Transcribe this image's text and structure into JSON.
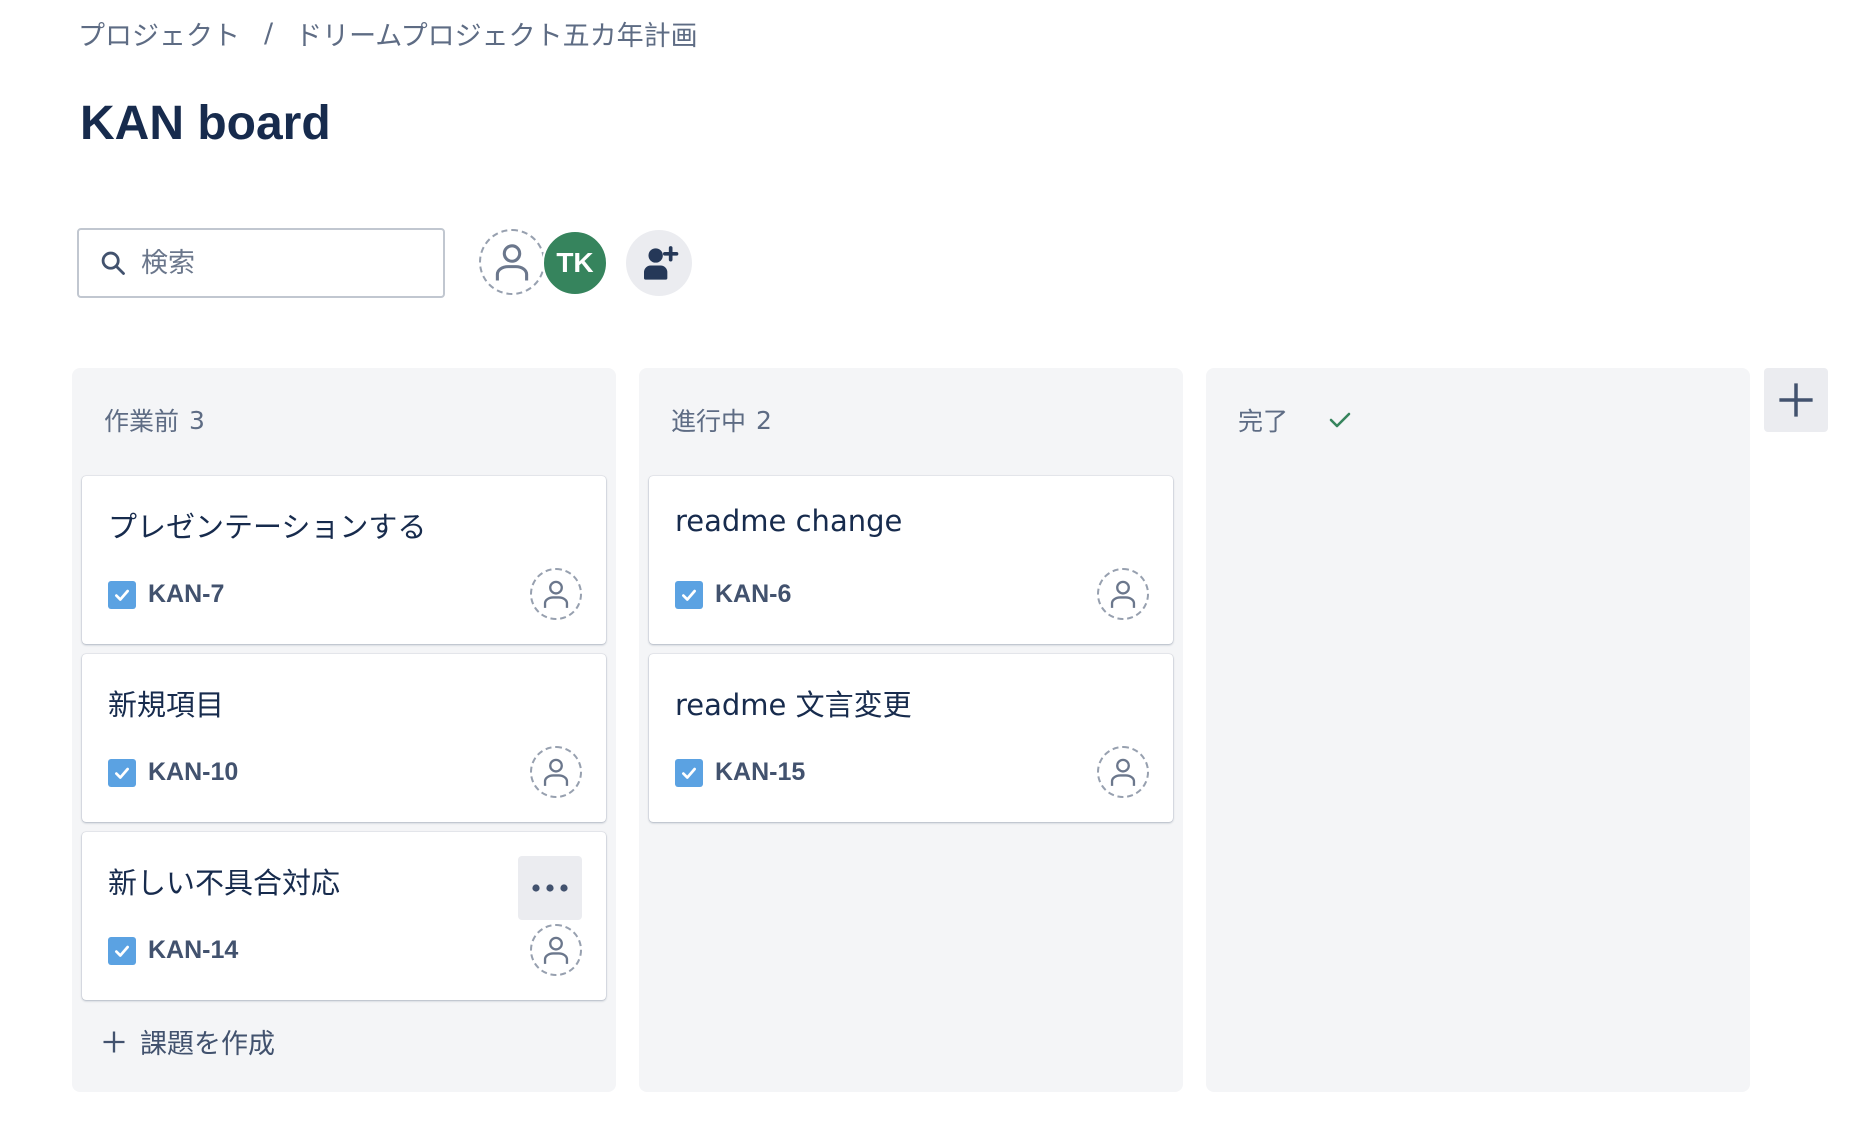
{
  "breadcrumb": {
    "project": "プロジェクト",
    "separator": "/",
    "current": "ドリームプロジェクト五カ年計画"
  },
  "page": {
    "title": "KAN board"
  },
  "search": {
    "placeholder": "検索",
    "value": "",
    "icon": "search-icon"
  },
  "avatars": [
    {
      "type": "unassigned",
      "icon": "person-icon"
    },
    {
      "type": "user",
      "initials": "TK",
      "color": "#36845d"
    },
    {
      "type": "add-people",
      "icon": "add-person-icon"
    }
  ],
  "columns": [
    {
      "title": "作業前",
      "count": "3",
      "cards": [
        {
          "title": "プレゼンテーションする",
          "key": "KAN-7"
        },
        {
          "title": "新規項目",
          "key": "KAN-10"
        },
        {
          "title": "新しい不具合対応",
          "key": "KAN-14",
          "more": "•••"
        }
      ],
      "create_label": "課題を作成"
    },
    {
      "title": "進行中",
      "count": "2",
      "cards": [
        {
          "title": "readme change",
          "key": "KAN-6"
        },
        {
          "title": "readme 文言変更",
          "key": "KAN-15"
        }
      ]
    },
    {
      "title": "完了",
      "count": "",
      "done_icon": "check-icon",
      "cards": []
    }
  ],
  "colors": {
    "checkbox": "#5ba2e2",
    "column_bg": "#f4f5f7",
    "done_check": "#36845d"
  }
}
